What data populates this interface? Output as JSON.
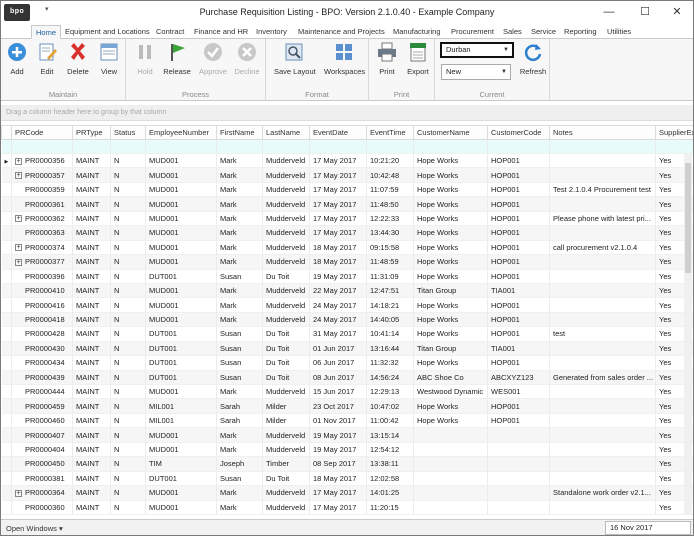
{
  "window": {
    "title": "Purchase Requisition Listing - BPO: Version 2.1.0.40 - Example Company",
    "logo": "bpo",
    "qat_symbol": "▾",
    "controls": {
      "minimize": "—",
      "restore": "☐",
      "close": "✕"
    }
  },
  "menu": {
    "tabs": [
      "Home",
      "Equipment and Locations",
      "Contract",
      "Finance and HR",
      "Inventory",
      "Maintenance and Projects",
      "Manufacturing",
      "Procurement",
      "Sales",
      "Service",
      "Reporting",
      "Utilities"
    ],
    "active": "Home"
  },
  "ribbon": {
    "groups": [
      {
        "label": "Maintain",
        "buttons": [
          {
            "label": "Add",
            "icon": "add-icon"
          },
          {
            "label": "Edit",
            "icon": "edit-icon"
          },
          {
            "label": "Delete",
            "icon": "delete-icon"
          },
          {
            "label": "View",
            "icon": "view-icon"
          }
        ]
      },
      {
        "label": "Process",
        "buttons": [
          {
            "label": "Hold",
            "icon": "hold-icon",
            "disabled": true
          },
          {
            "label": "Release",
            "icon": "release-flag-icon"
          },
          {
            "label": "Approve",
            "icon": "approve-check-icon",
            "disabled": true
          },
          {
            "label": "Decline",
            "icon": "decline-x-icon",
            "disabled": true
          }
        ]
      },
      {
        "label": "Format",
        "buttons": [
          {
            "label": "Save Layout",
            "icon": "save-layout-icon"
          },
          {
            "label": "Workspaces",
            "icon": "workspaces-icon"
          }
        ]
      },
      {
        "label": "Print",
        "buttons": [
          {
            "label": "Print",
            "icon": "printer-icon"
          },
          {
            "label": "Export",
            "icon": "export-xlsx-icon"
          }
        ]
      },
      {
        "label": "Current",
        "site": "Durban",
        "status": "New",
        "buttons": [
          {
            "label": "Refresh",
            "icon": "refresh-icon"
          }
        ]
      }
    ]
  },
  "grid": {
    "group_hint": "Drag a column header here to group by that column",
    "columns": [
      "PRCode",
      "PRType",
      "Status",
      "EmployeeNumber",
      "FirstName",
      "LastName",
      "EventDate",
      "EventTime",
      "CustomerName",
      "CustomerCode",
      "Notes",
      "SupplierEx"
    ],
    "rows": [
      {
        "exp": true,
        "cur": true,
        "c": [
          "PR0000356",
          "MAINT",
          "N",
          "MUD001",
          "Mark",
          "Mudderveld",
          "17 May 2017",
          "10:21:20",
          "Hope Works",
          "HOP001",
          "",
          "Yes"
        ]
      },
      {
        "exp": true,
        "c": [
          "PR0000357",
          "MAINT",
          "N",
          "MUD001",
          "Mark",
          "Mudderveld",
          "17 May 2017",
          "10:42:48",
          "Hope Works",
          "HOP001",
          "",
          "Yes"
        ]
      },
      {
        "exp": false,
        "c": [
          "PR0000359",
          "MAINT",
          "N",
          "MUD001",
          "Mark",
          "Mudderveld",
          "17 May 2017",
          "11:07:59",
          "Hope Works",
          "HOP001",
          "Test 2.1.0.4 Procurement test",
          "Yes"
        ]
      },
      {
        "exp": false,
        "c": [
          "PR0000361",
          "MAINT",
          "N",
          "MUD001",
          "Mark",
          "Mudderveld",
          "17 May 2017",
          "11:48:50",
          "Hope Works",
          "HOP001",
          "",
          "Yes"
        ]
      },
      {
        "exp": true,
        "c": [
          "PR0000362",
          "MAINT",
          "N",
          "MUD001",
          "Mark",
          "Mudderveld",
          "17 May 2017",
          "12:22:33",
          "Hope Works",
          "HOP001",
          "Please phone with latest pri...",
          "Yes"
        ]
      },
      {
        "exp": false,
        "c": [
          "PR0000363",
          "MAINT",
          "N",
          "MUD001",
          "Mark",
          "Mudderveld",
          "17 May 2017",
          "13:44:30",
          "Hope Works",
          "HOP001",
          "",
          "Yes"
        ]
      },
      {
        "exp": true,
        "c": [
          "PR0000374",
          "MAINT",
          "N",
          "MUD001",
          "Mark",
          "Mudderveld",
          "18 May 2017",
          "09:15:58",
          "Hope Works",
          "HOP001",
          "call procurement v2.1.0.4",
          "Yes"
        ]
      },
      {
        "exp": true,
        "c": [
          "PR0000377",
          "MAINT",
          "N",
          "MUD001",
          "Mark",
          "Mudderveld",
          "18 May 2017",
          "11:48:59",
          "Hope Works",
          "HOP001",
          "",
          "Yes"
        ]
      },
      {
        "exp": false,
        "c": [
          "PR0000396",
          "MAINT",
          "N",
          "DUT001",
          "Susan",
          "Du Toit",
          "19 May 2017",
          "11:31:09",
          "Hope Works",
          "HOP001",
          "",
          "Yes"
        ]
      },
      {
        "exp": false,
        "c": [
          "PR0000410",
          "MAINT",
          "N",
          "MUD001",
          "Mark",
          "Mudderveld",
          "22 May 2017",
          "12:47:51",
          "Titan Group",
          "TIA001",
          "",
          "Yes"
        ]
      },
      {
        "exp": false,
        "c": [
          "PR0000416",
          "MAINT",
          "N",
          "MUD001",
          "Mark",
          "Mudderveld",
          "24 May 2017",
          "14:18:21",
          "Hope Works",
          "HOP001",
          "",
          "Yes"
        ]
      },
      {
        "exp": false,
        "c": [
          "PR0000418",
          "MAINT",
          "N",
          "MUD001",
          "Mark",
          "Mudderveld",
          "24 May 2017",
          "14:40:05",
          "Hope Works",
          "HOP001",
          "",
          "Yes"
        ]
      },
      {
        "exp": false,
        "c": [
          "PR0000428",
          "MAINT",
          "N",
          "DUT001",
          "Susan",
          "Du Toit",
          "31 May 2017",
          "10:41:14",
          "Hope Works",
          "HOP001",
          "test",
          "Yes"
        ]
      },
      {
        "exp": false,
        "c": [
          "PR0000430",
          "MAINT",
          "N",
          "DUT001",
          "Susan",
          "Du Toit",
          "01 Jun 2017",
          "13:16:44",
          "Titan Group",
          "TIA001",
          "",
          "Yes"
        ]
      },
      {
        "exp": false,
        "c": [
          "PR0000434",
          "MAINT",
          "N",
          "DUT001",
          "Susan",
          "Du Toit",
          "06 Jun 2017",
          "11:32:32",
          "Hope Works",
          "HOP001",
          "",
          "Yes"
        ]
      },
      {
        "exp": false,
        "c": [
          "PR0000439",
          "MAINT",
          "N",
          "DUT001",
          "Susan",
          "Du Toit",
          "08 Jun 2017",
          "14:56:24",
          "ABC Shoe Co",
          "ABCXYZ123",
          "Generated from sales order ...",
          "Yes"
        ]
      },
      {
        "exp": false,
        "c": [
          "PR0000444",
          "MAINT",
          "N",
          "MUD001",
          "Mark",
          "Mudderveld",
          "15 Jun 2017",
          "12:29:13",
          "Westwood Dynamic",
          "WES001",
          "",
          "Yes"
        ]
      },
      {
        "exp": false,
        "c": [
          "PR0000459",
          "MAINT",
          "N",
          "MIL001",
          "Sarah",
          "Milder",
          "23 Oct 2017",
          "10:47:02",
          "Hope Works",
          "HOP001",
          "",
          "Yes"
        ]
      },
      {
        "exp": false,
        "c": [
          "PR0000460",
          "MAINT",
          "N",
          "MIL001",
          "Sarah",
          "Milder",
          "01 Nov 2017",
          "11:00:42",
          "Hope Works",
          "HOP001",
          "",
          "Yes"
        ]
      },
      {
        "exp": false,
        "c": [
          "PR0000407",
          "MAINT",
          "N",
          "MUD001",
          "Mark",
          "Mudderveld",
          "19 May 2017",
          "13:15:14",
          "",
          "",
          "",
          "Yes"
        ]
      },
      {
        "exp": false,
        "c": [
          "PR0000404",
          "MAINT",
          "N",
          "MUD001",
          "Mark",
          "Mudderveld",
          "19 May 2017",
          "12:54:12",
          "",
          "",
          "",
          "Yes"
        ]
      },
      {
        "exp": false,
        "c": [
          "PR0000450",
          "MAINT",
          "N",
          "TIM",
          "Joseph",
          "Timber",
          "08 Sep 2017",
          "13:38:11",
          "",
          "",
          "",
          "Yes"
        ]
      },
      {
        "exp": false,
        "c": [
          "PR0000381",
          "MAINT",
          "N",
          "DUT001",
          "Susan",
          "Du Toit",
          "18 May 2017",
          "12:02:58",
          "",
          "",
          "",
          "Yes"
        ]
      },
      {
        "exp": true,
        "c": [
          "PR0000364",
          "MAINT",
          "N",
          "MUD001",
          "Mark",
          "Mudderveld",
          "17 May 2017",
          "14:01:25",
          "",
          "",
          "Standalone work order v2.1...",
          "Yes"
        ]
      },
      {
        "exp": false,
        "c": [
          "PR0000360",
          "MAINT",
          "N",
          "MUD001",
          "Mark",
          "Mudderveld",
          "17 May 2017",
          "11:20:15",
          "",
          "",
          "",
          "Yes"
        ]
      }
    ]
  },
  "status": {
    "open_windows": "Open Windows ▾",
    "date": "16 Nov 2017"
  },
  "colors": {
    "accent": "#1a5aa0",
    "filter_row": "#e8fbfb",
    "ribbon_bg": "#f7f7f7"
  }
}
